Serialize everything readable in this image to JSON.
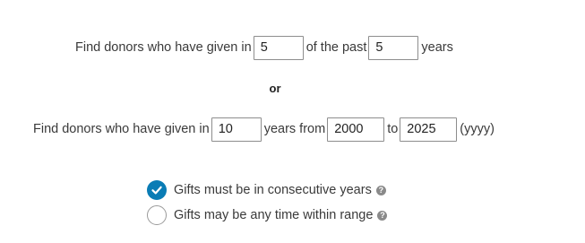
{
  "row1": {
    "prefix": "Find donors who have given in",
    "count_value": "5",
    "middle": "of the past",
    "years_value": "5",
    "suffix": "years"
  },
  "separator": "or",
  "row2": {
    "prefix": "Find donors who have given in",
    "count_value": "10",
    "middle": "years from",
    "from_value": "2000",
    "to_label": "to",
    "to_value": "2025",
    "format_hint": "(yyyy)"
  },
  "options": [
    {
      "label": "Gifts must be in consecutive years",
      "selected": true
    },
    {
      "label": "Gifts may be any time within range",
      "selected": false
    }
  ],
  "icons": {
    "check": "check-icon",
    "help": "help-circle-icon"
  },
  "colors": {
    "accent": "#0a7cb5",
    "text": "#3a3a3a"
  }
}
